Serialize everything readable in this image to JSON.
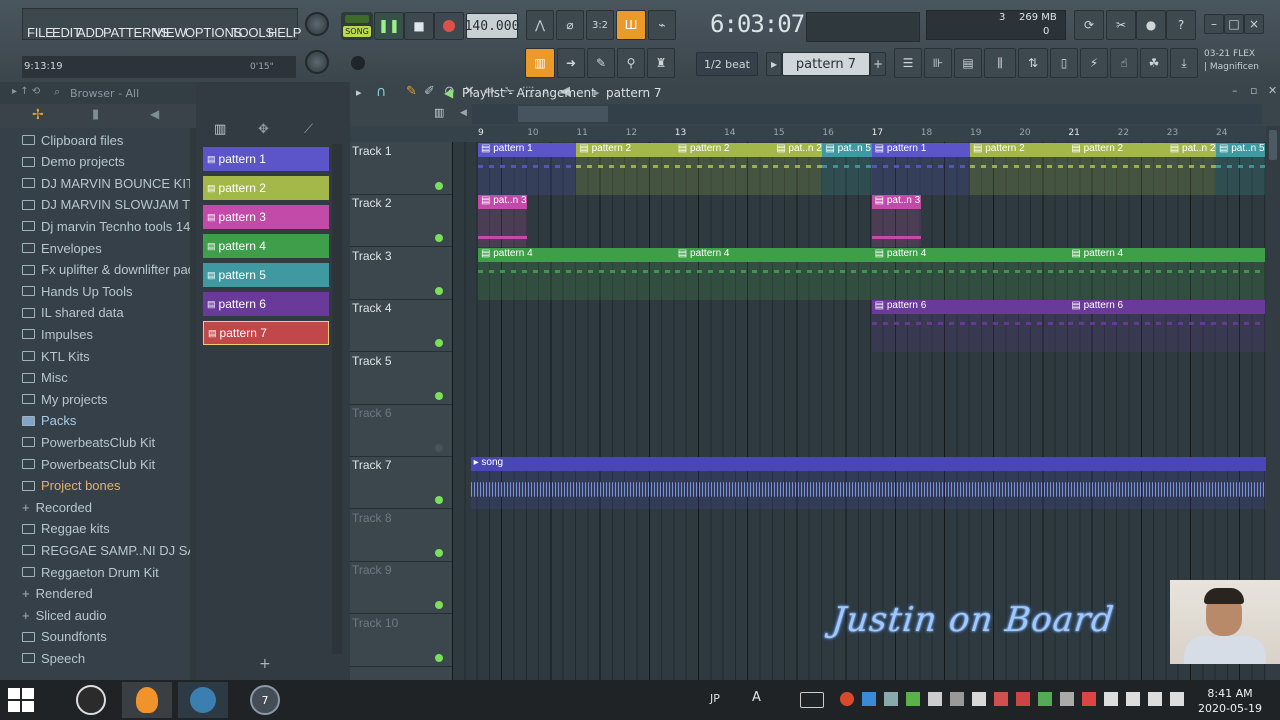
{
  "menu": {
    "file": "FILE",
    "edit": "EDIT",
    "add": "ADD",
    "patterns": "PATTERNS",
    "view": "VIEW",
    "options": "OPTIONS",
    "tools": "TOOLS",
    "help": "HELP"
  },
  "transport": {
    "song_label": "SONG",
    "tempo": "140.000",
    "time": "6:03:07",
    "beat_unit": "1/2 beat",
    "pattern": "pattern 7",
    "hint": "9:13:19",
    "hint_right": "0'15\"",
    "cpu_num": "3",
    "memory": "269 MB",
    "poly": "0"
  },
  "news": {
    "line1": "03-21  FLEX",
    "line2": "| Magnificen"
  },
  "browser": {
    "title": "Browser - All",
    "items": [
      {
        "label": "Clipboard files",
        "icon": "folder-icon"
      },
      {
        "label": "Demo projects",
        "icon": "folder-icon"
      },
      {
        "label": "DJ MARVIN BOUNCE KITS",
        "icon": "folder-icon"
      },
      {
        "label": "DJ MARVIN SLOWJAM TOOLS",
        "icon": "folder-icon"
      },
      {
        "label": "Dj marvin Tecnho tools 140",
        "icon": "folder-icon"
      },
      {
        "label": "Envelopes",
        "icon": "folder-icon"
      },
      {
        "label": "Fx uplifter & downlifter pack",
        "icon": "folder-icon"
      },
      {
        "label": "Hands Up Tools",
        "icon": "folder-icon"
      },
      {
        "label": "IL shared data",
        "icon": "folder-icon"
      },
      {
        "label": "Impulses",
        "icon": "folder-icon"
      },
      {
        "label": "KTL Kits",
        "icon": "folder-icon"
      },
      {
        "label": "Misc",
        "icon": "folder-icon"
      },
      {
        "label": "My projects",
        "icon": "folder-icon"
      },
      {
        "label": "Packs",
        "icon": "packs-icon"
      },
      {
        "label": "PowerbeatsClub Kit",
        "icon": "folder-icon"
      },
      {
        "label": "PowerbeatsClub Kit",
        "icon": "folder-icon"
      },
      {
        "label": "Project bones",
        "icon": "folder-icon"
      },
      {
        "label": "Recorded",
        "icon": "plus-icon"
      },
      {
        "label": "Reggae kits",
        "icon": "folder-icon"
      },
      {
        "label": "REGGAE SAMP..NI DJ SANDY",
        "icon": "folder-icon"
      },
      {
        "label": "Reggaeton Drum Kit",
        "icon": "folder-icon"
      },
      {
        "label": "Rendered",
        "icon": "plus-icon"
      },
      {
        "label": "Sliced audio",
        "icon": "plus-icon"
      },
      {
        "label": "Soundfonts",
        "icon": "folder-icon"
      },
      {
        "label": "Speech",
        "icon": "folder-icon"
      }
    ]
  },
  "patterns": [
    {
      "label": "pattern 1",
      "color": "#5b55c9"
    },
    {
      "label": "pattern 2",
      "color": "#a4b84a"
    },
    {
      "label": "pattern 3",
      "color": "#c24aa8"
    },
    {
      "label": "pattern 4",
      "color": "#3f9e4a"
    },
    {
      "label": "pattern 5",
      "color": "#3e9aa0"
    },
    {
      "label": "pattern 6",
      "color": "#6a3a9a"
    },
    {
      "label": "pattern 7",
      "color": "#c2474a"
    }
  ],
  "playlist": {
    "title": "Playlist - Arrangement",
    "pattern": "pattern 7",
    "bar_numbers": [
      "9",
      "10",
      "11",
      "12",
      "13",
      "14",
      "15",
      "16",
      "17",
      "18",
      "19",
      "20",
      "21",
      "22",
      "23",
      "24"
    ],
    "tracks": [
      "Track 1",
      "Track 2",
      "Track 3",
      "Track 4",
      "Track 5",
      "Track 6",
      "Track 7",
      "Track 8",
      "Track 9",
      "Track 10"
    ],
    "clips": {
      "t1": [
        {
          "label": "pattern 1",
          "color": "#5b55c9",
          "start": 9,
          "len": 2
        },
        {
          "label": "pattern 2",
          "color": "#a4b84a",
          "start": 11,
          "len": 2
        },
        {
          "label": "pattern 2",
          "color": "#a4b84a",
          "start": 13,
          "len": 2
        },
        {
          "label": "pat..n 2",
          "color": "#a4b84a",
          "start": 15,
          "len": 1
        },
        {
          "label": "pat..n 5",
          "color": "#3e9aa0",
          "start": 16,
          "len": 1
        },
        {
          "label": "pattern 1",
          "color": "#5b55c9",
          "start": 17,
          "len": 2
        },
        {
          "label": "pattern 2",
          "color": "#a4b84a",
          "start": 19,
          "len": 2
        },
        {
          "label": "pattern 2",
          "color": "#a4b84a",
          "start": 21,
          "len": 2
        },
        {
          "label": "pat..n 2",
          "color": "#a4b84a",
          "start": 23,
          "len": 1
        },
        {
          "label": "pat..n 5",
          "color": "#3e9aa0",
          "start": 24,
          "len": 1
        }
      ],
      "t2": [
        {
          "label": "pat..n 3",
          "color": "#c24aa8",
          "start": 9,
          "len": 1
        },
        {
          "label": "pat..n 3",
          "color": "#c24aa8",
          "start": 17,
          "len": 1
        }
      ],
      "t3": [
        {
          "label": "pattern 4",
          "color": "#3f9e4a",
          "start": 9,
          "len": 4
        },
        {
          "label": "pattern 4",
          "color": "#3f9e4a",
          "start": 13,
          "len": 4
        },
        {
          "label": "pattern 4",
          "color": "#3f9e4a",
          "start": 17,
          "len": 4
        },
        {
          "label": "pattern 4",
          "color": "#3f9e4a",
          "start": 21,
          "len": 4
        }
      ],
      "t4": [
        {
          "label": "pattern 6",
          "color": "#6a3a9a",
          "start": 17,
          "len": 4
        },
        {
          "label": "pattern 6",
          "color": "#6a3a9a",
          "start": 21,
          "len": 4
        }
      ],
      "t7": [
        {
          "label": "song",
          "color": "#4a46b8",
          "start": 8.85,
          "len": 16.2
        }
      ]
    }
  },
  "watermark": "Justin on Board",
  "taskbar": {
    "lang": "JP",
    "ime": "A",
    "clock_time": "8:41 AM",
    "clock_date": "2020-05-19",
    "pinned_badge": "7"
  }
}
